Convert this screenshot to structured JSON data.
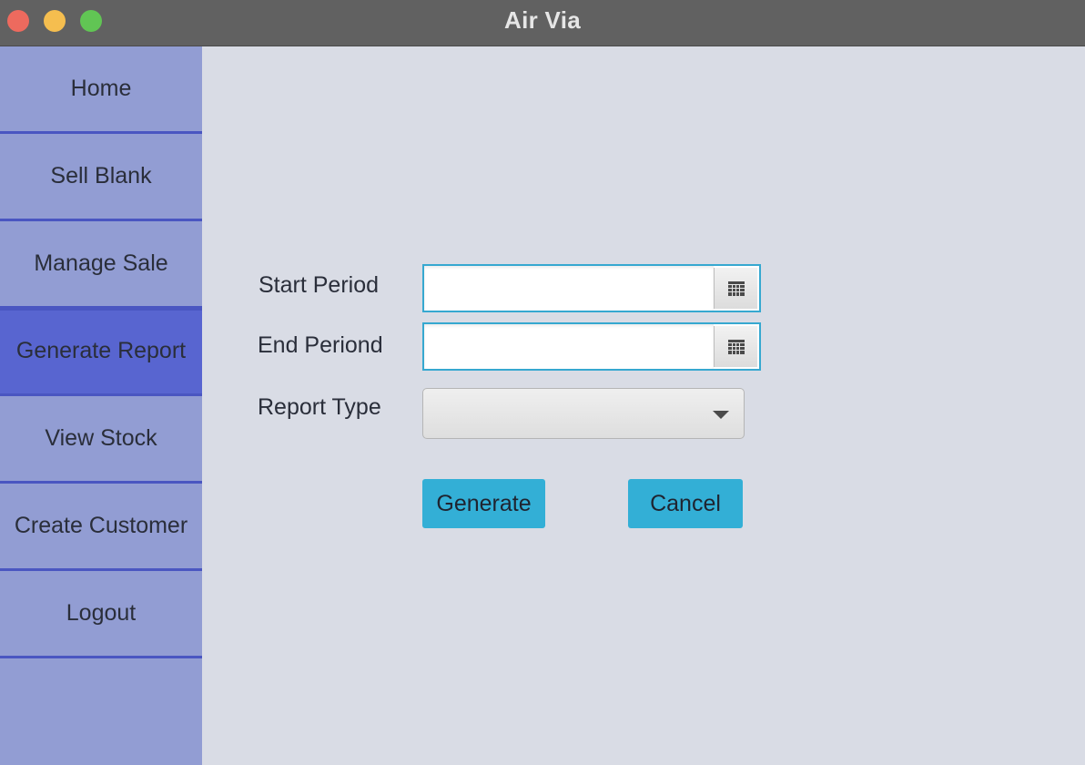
{
  "window": {
    "title": "Air Via"
  },
  "sidebar": {
    "items": [
      {
        "label": "Home"
      },
      {
        "label": "Sell Blank"
      },
      {
        "label": "Manage Sale"
      },
      {
        "label": "Generate Report",
        "active": true
      },
      {
        "label": "View Stock"
      },
      {
        "label": "Create Customer"
      },
      {
        "label": "Logout"
      }
    ]
  },
  "form": {
    "start_period": {
      "label": "Start Period",
      "value": "",
      "icon": "calendar-icon"
    },
    "end_period": {
      "label": "End Periond",
      "value": "",
      "icon": "calendar-icon"
    },
    "report_type": {
      "label": "Report Type",
      "value": ""
    },
    "generate_label": "Generate",
    "cancel_label": "Cancel"
  },
  "colors": {
    "titlebar": "#616161",
    "sidebar": "#929dd3",
    "sidebar_active": "#5865d0",
    "sidebar_divider": "#4a56c1",
    "content_bg": "#d9dce5",
    "accent": "#33afd6"
  }
}
